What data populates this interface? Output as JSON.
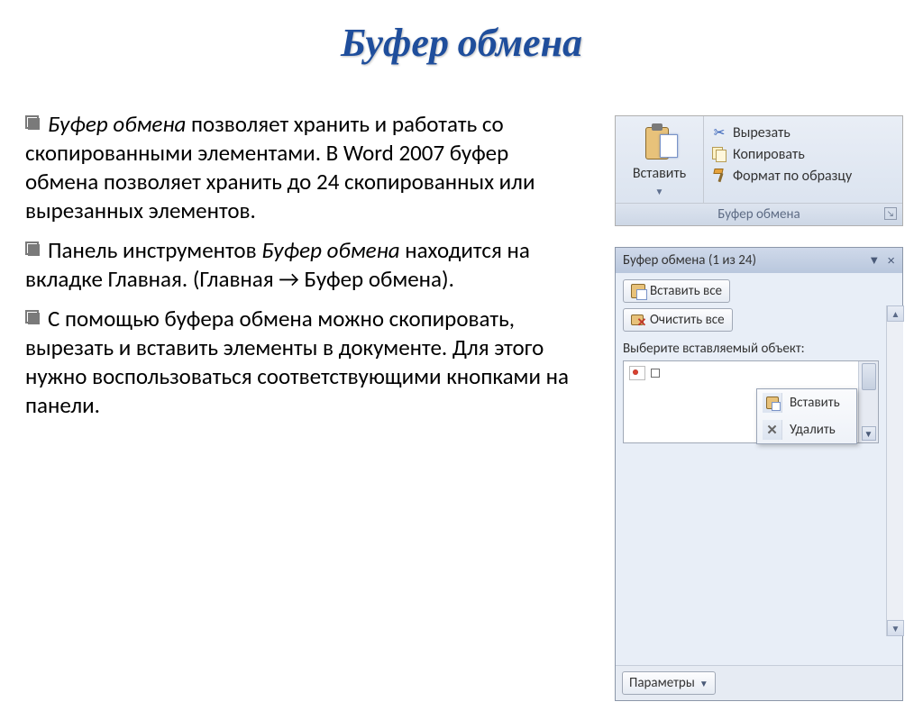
{
  "title": "Буфер обмена",
  "bullets": [
    {
      "pre_italic": "Буфер обмена",
      "rest": " позволяет хранить и работать со скопированными элементами. В Word 2007 буфер обмена позволяет хранить до 24 скопированных или вырезанных элементов."
    },
    {
      "pre": "Панель инструментов ",
      "italic": "Буфер обмена",
      "rest": " находится на вкладке Главная.  (Главная → Буфер обмена)."
    },
    {
      "pre": "С помощью буфера обмена можно скопировать, вырезать и вставить элементы в документе. Для этого нужно воспользоваться соответствующими кнопками на панели."
    }
  ],
  "ribbon": {
    "paste": "Вставить",
    "cut": "Вырезать",
    "copy": "Копировать",
    "format": "Формат по образцу",
    "group": "Буфер обмена"
  },
  "pane": {
    "title": "Буфер обмена (1 из 24)",
    "paste_all": "Вставить все",
    "clear_all": "Очистить все",
    "select_label": "Выберите вставляемый объект:",
    "ctx_paste": "Вставить",
    "ctx_delete": "Удалить",
    "params": "Параметры"
  }
}
